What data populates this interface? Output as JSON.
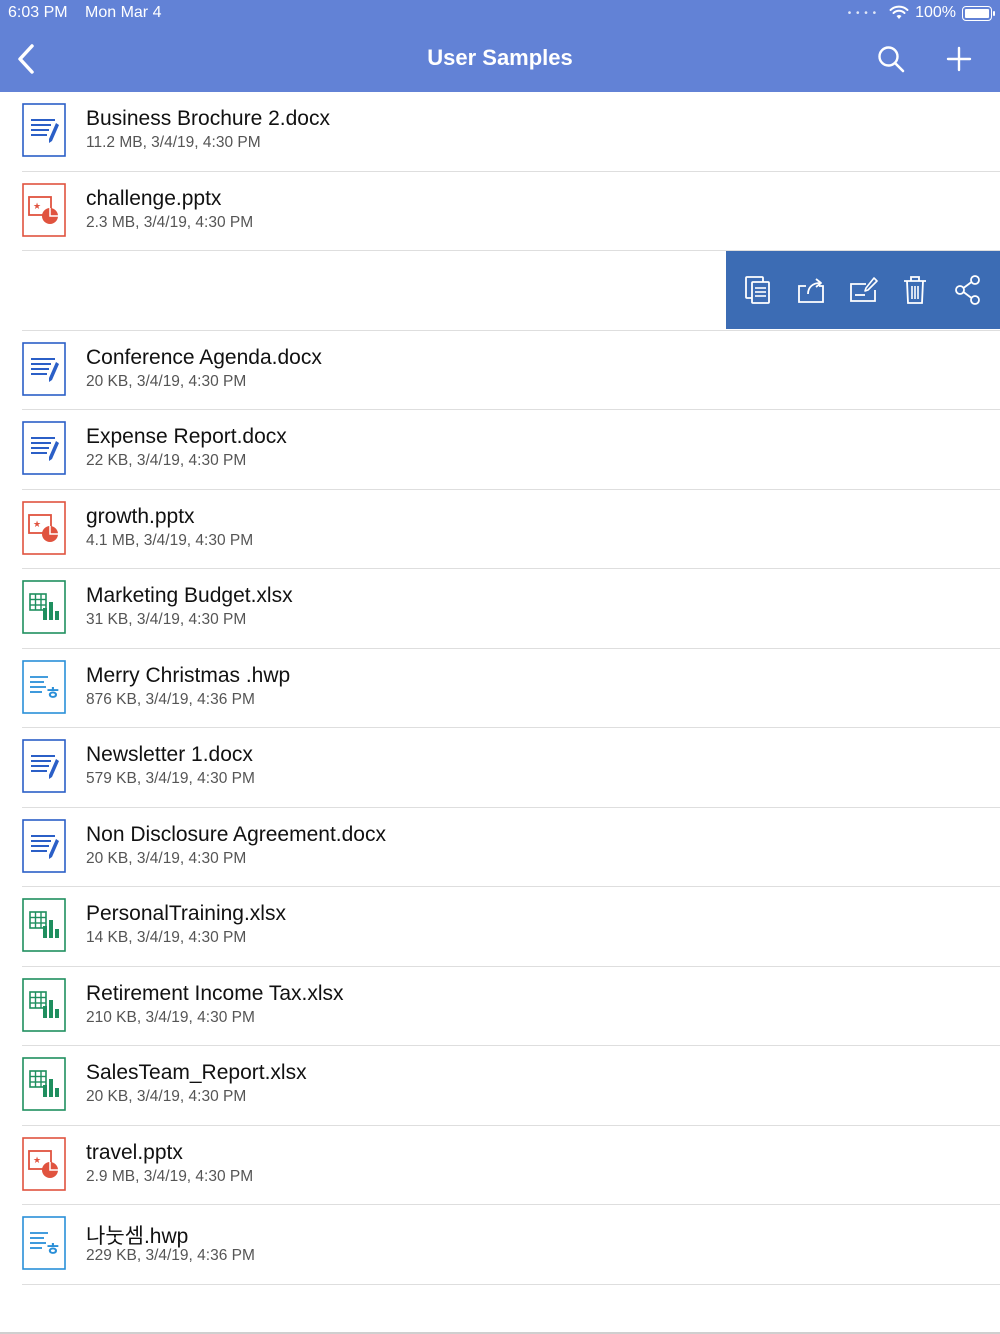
{
  "status_bar": {
    "time": "6:03 PM",
    "date": "Mon Mar 4",
    "battery": "100%"
  },
  "header": {
    "title": "User Samples",
    "back_icon": "chevron-left-icon",
    "search_icon": "search-icon",
    "add_icon": "plus-icon",
    "color": "#6282d6"
  },
  "action_bar": {
    "color": "#3c6cb4",
    "actions": [
      "copy-icon",
      "export-icon",
      "rename-icon",
      "trash-icon",
      "share-icon"
    ]
  },
  "files_top": [
    {
      "name": "Business Brochure 2.docx",
      "meta": "11.2 MB, 3/4/19, 4:30 PM",
      "type": "docx"
    },
    {
      "name": "challenge.pptx",
      "meta": "2.3 MB, 3/4/19, 4:30 PM",
      "type": "pptx"
    }
  ],
  "files_bottom": [
    {
      "name": "Conference Agenda.docx",
      "meta": "20 KB, 3/4/19, 4:30 PM",
      "type": "docx"
    },
    {
      "name": "Expense Report.docx",
      "meta": "22 KB, 3/4/19, 4:30 PM",
      "type": "docx"
    },
    {
      "name": "growth.pptx",
      "meta": "4.1 MB, 3/4/19, 4:30 PM",
      "type": "pptx"
    },
    {
      "name": "Marketing Budget.xlsx",
      "meta": "31 KB, 3/4/19, 4:30 PM",
      "type": "xlsx"
    },
    {
      "name": "Merry Christmas .hwp",
      "meta": "876 KB, 3/4/19, 4:36 PM",
      "type": "hwp"
    },
    {
      "name": "Newsletter 1.docx",
      "meta": "579 KB, 3/4/19, 4:30 PM",
      "type": "docx"
    },
    {
      "name": "Non Disclosure Agreement.docx",
      "meta": "20 KB, 3/4/19, 4:30 PM",
      "type": "docx"
    },
    {
      "name": "PersonalTraining.xlsx",
      "meta": "14 KB, 3/4/19, 4:30 PM",
      "type": "xlsx"
    },
    {
      "name": "Retirement Income Tax.xlsx",
      "meta": "210 KB, 3/4/19, 4:30 PM",
      "type": "xlsx"
    },
    {
      "name": "SalesTeam_Report.xlsx",
      "meta": "20 KB, 3/4/19, 4:30 PM",
      "type": "xlsx"
    },
    {
      "name": "travel.pptx",
      "meta": "2.9 MB, 3/4/19, 4:30 PM",
      "type": "pptx"
    },
    {
      "name": "나눗셈.hwp",
      "meta": "229 KB, 3/4/19, 4:36 PM",
      "type": "hwp"
    }
  ],
  "file_type_colors": {
    "docx": "#2b5fc7",
    "pptx": "#e0533f",
    "xlsx": "#1f8f5f",
    "hwp": "#2a8fd8"
  }
}
